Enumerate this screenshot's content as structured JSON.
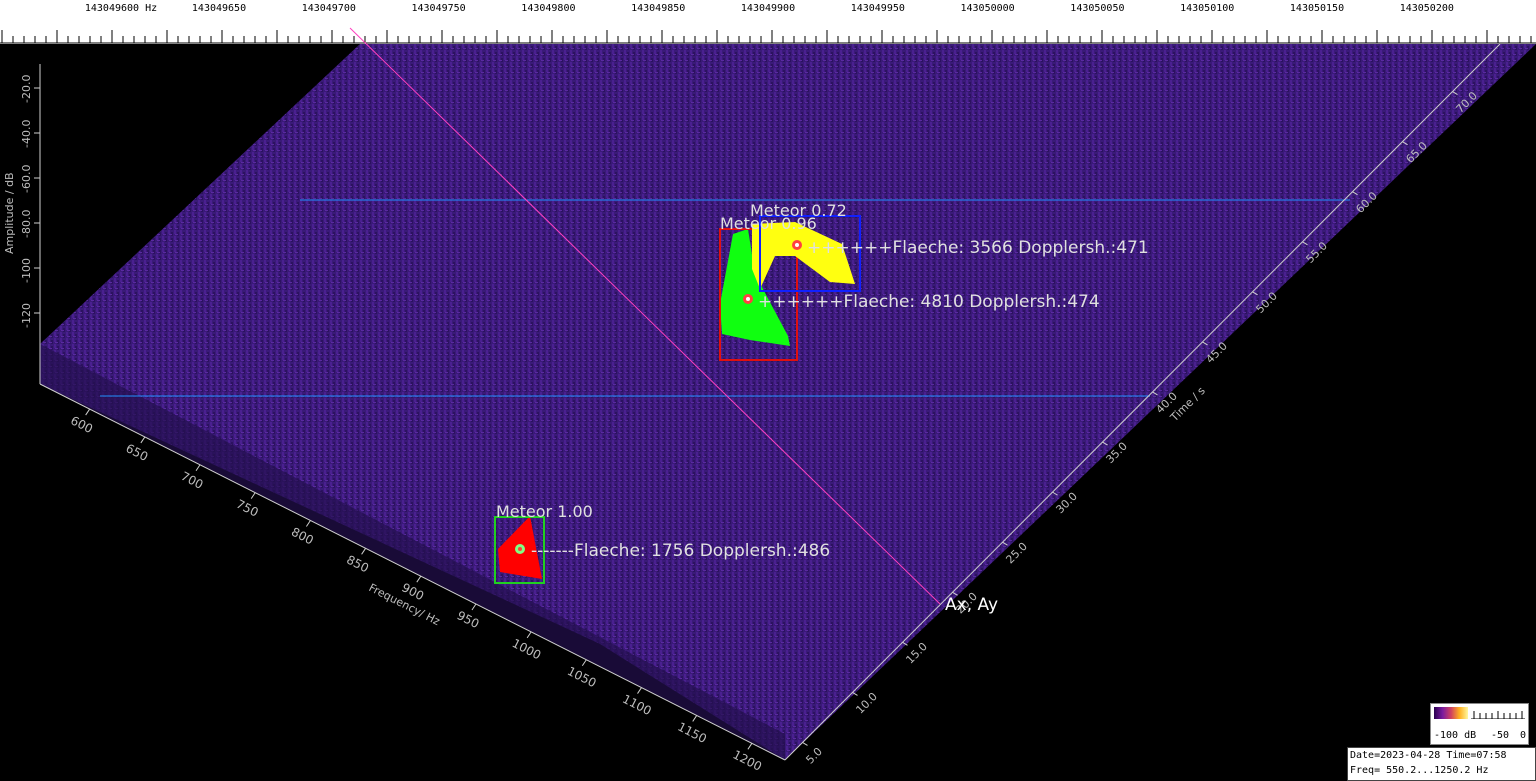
{
  "freq_axis": {
    "labels": [
      "143049600 Hz",
      "143049650",
      "143049700",
      "143049750",
      "143049800",
      "143049850",
      "143049900",
      "143049950",
      "143050000",
      "143050050",
      "143050100",
      "143050150",
      "143050200"
    ]
  },
  "amplitude_axis": {
    "title": "Amplitude / dB",
    "ticks": [
      "-20.0",
      "-40.0",
      "-60.0",
      "-80.0",
      "-100",
      "-120"
    ]
  },
  "frequency_axis": {
    "title": "Frequency/ Hz",
    "ticks": [
      "600",
      "650",
      "700",
      "750",
      "800",
      "850",
      "900",
      "950",
      "1000",
      "1050",
      "1100",
      "1150",
      "1200"
    ]
  },
  "time_axis": {
    "title": "Time / s",
    "ticks": [
      "5.0",
      "10.0",
      "15.0",
      "20.0",
      "25.0",
      "30.0",
      "35.0",
      "40.0",
      "45.0",
      "50.0",
      "55.0",
      "60.0",
      "65.0",
      "70.0"
    ]
  },
  "detections": [
    {
      "label": "Meteor 1.00",
      "info": "-------Flaeche: 1756 Dopplersh.:486",
      "box_color": "#20d020",
      "blob_color": "#ff0000"
    },
    {
      "label": "Meteor 0.96",
      "info": "++++++Flaeche: 4810 Dopplersh.:474",
      "box_color": "#e01010",
      "blob_color": "#10ff10"
    },
    {
      "label": "Meteor 0.72",
      "info": "++++++Flaeche: 3566 Dopplersh.:471",
      "box_color": "#1020ff",
      "blob_color": "#ffff10"
    }
  ],
  "cursor_label": "Ax, Ay",
  "legend": {
    "low": "-100 dB",
    "mid": "-50",
    "high": "0"
  },
  "info": {
    "line1": "Date=2023-04-28 Time=07:58",
    "line2": "Freq= 550.2...1250.2 Hz"
  },
  "colors": {
    "surface": "#3a1a78",
    "surface_dark": "#24104f",
    "guide_line": "#2090ff",
    "cursor_line": "#ff40c0",
    "text": "#e0e0e0"
  }
}
